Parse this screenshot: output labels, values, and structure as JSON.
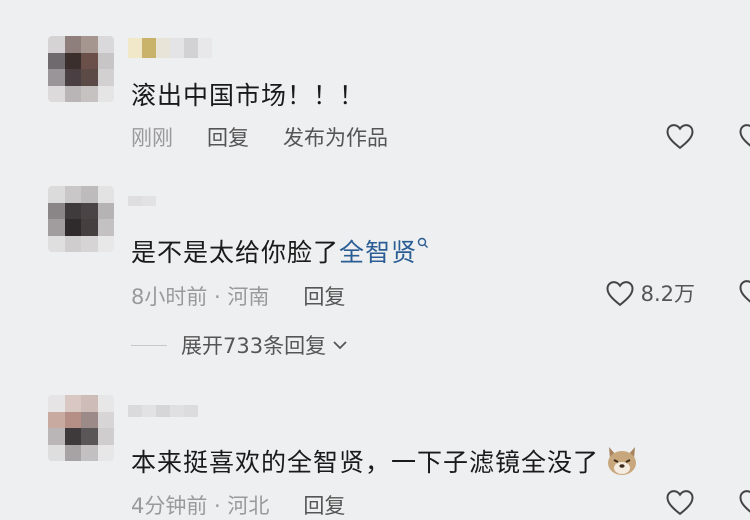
{
  "comments": [
    {
      "text": "滚出中国市场！！！",
      "time": "刚刚",
      "reply_label": "回复",
      "publish_label": "发布为作品",
      "likes": ""
    },
    {
      "text_prefix": "是不是太给你脸了",
      "link_text": "全智贤",
      "time_location": "8小时前 · 河南",
      "reply_label": "回复",
      "likes": "8.2万",
      "expand_label": "展开733条回复"
    },
    {
      "text": "本来挺喜欢的全智贤，一下子滤镜全没了",
      "time_location": "4分钟前 · 河北",
      "reply_label": "回复"
    }
  ],
  "icons": [
    "heart-icon",
    "search-icon",
    "chevron-down-icon",
    "dog-emoji-icon"
  ],
  "colors": {
    "background": "#eeeff1",
    "link": "#2a5d94",
    "text": "#1a1a1a",
    "meta": "#9a9a9a"
  }
}
